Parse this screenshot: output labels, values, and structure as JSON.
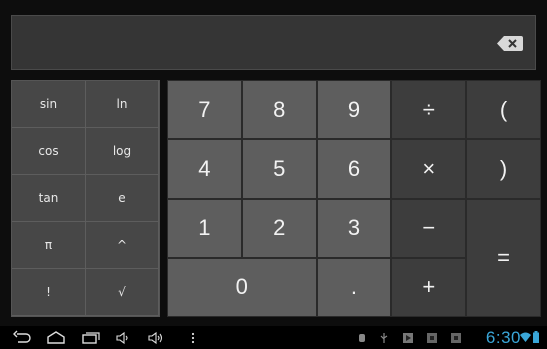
{
  "display": {
    "expression": ""
  },
  "scientific": {
    "keys": [
      {
        "label": "sin",
        "name": "sin-key"
      },
      {
        "label": "ln",
        "name": "ln-key"
      },
      {
        "label": "cos",
        "name": "cos-key"
      },
      {
        "label": "log",
        "name": "log-key"
      },
      {
        "label": "tan",
        "name": "tan-key"
      },
      {
        "label": "e",
        "name": "e-key"
      },
      {
        "label": "π",
        "name": "pi-key"
      },
      {
        "label": "^",
        "name": "power-key"
      },
      {
        "label": "!",
        "name": "factorial-key"
      },
      {
        "label": "√",
        "name": "sqrt-key"
      }
    ]
  },
  "keypad": {
    "keys": [
      {
        "label": "7",
        "name": "digit-7-key",
        "kind": "num"
      },
      {
        "label": "8",
        "name": "digit-8-key",
        "kind": "num"
      },
      {
        "label": "9",
        "name": "digit-9-key",
        "kind": "num"
      },
      {
        "label": "÷",
        "name": "divide-key",
        "kind": "op"
      },
      {
        "label": "(",
        "name": "open-paren-key",
        "kind": "op"
      },
      {
        "label": "4",
        "name": "digit-4-key",
        "kind": "num"
      },
      {
        "label": "5",
        "name": "digit-5-key",
        "kind": "num"
      },
      {
        "label": "6",
        "name": "digit-6-key",
        "kind": "num"
      },
      {
        "label": "×",
        "name": "multiply-key",
        "kind": "op"
      },
      {
        "label": ")",
        "name": "close-paren-key",
        "kind": "op"
      },
      {
        "label": "1",
        "name": "digit-1-key",
        "kind": "num"
      },
      {
        "label": "2",
        "name": "digit-2-key",
        "kind": "num"
      },
      {
        "label": "3",
        "name": "digit-3-key",
        "kind": "num"
      },
      {
        "label": "−",
        "name": "minus-key",
        "kind": "op"
      },
      {
        "label": "=",
        "name": "equals-key",
        "kind": "op"
      },
      {
        "label": "0",
        "name": "digit-0-key",
        "kind": "num"
      },
      {
        "label": ".",
        "name": "decimal-key",
        "kind": "num"
      },
      {
        "label": "+",
        "name": "plus-key",
        "kind": "op"
      }
    ]
  },
  "navbar": {
    "buttons": [
      "back-icon",
      "home-icon",
      "recent-apps-icon",
      "volume-down-icon",
      "volume-up-icon",
      "menu-icon"
    ],
    "status_icons": [
      "debug-icon",
      "usb-icon",
      "play-store-icon",
      "notification-icon",
      "notification-icon-2"
    ],
    "clock": "6:30",
    "wifi_icon": "wifi-icon",
    "battery_icon": "battery-icon",
    "accent_color": "#3aa6d8"
  }
}
